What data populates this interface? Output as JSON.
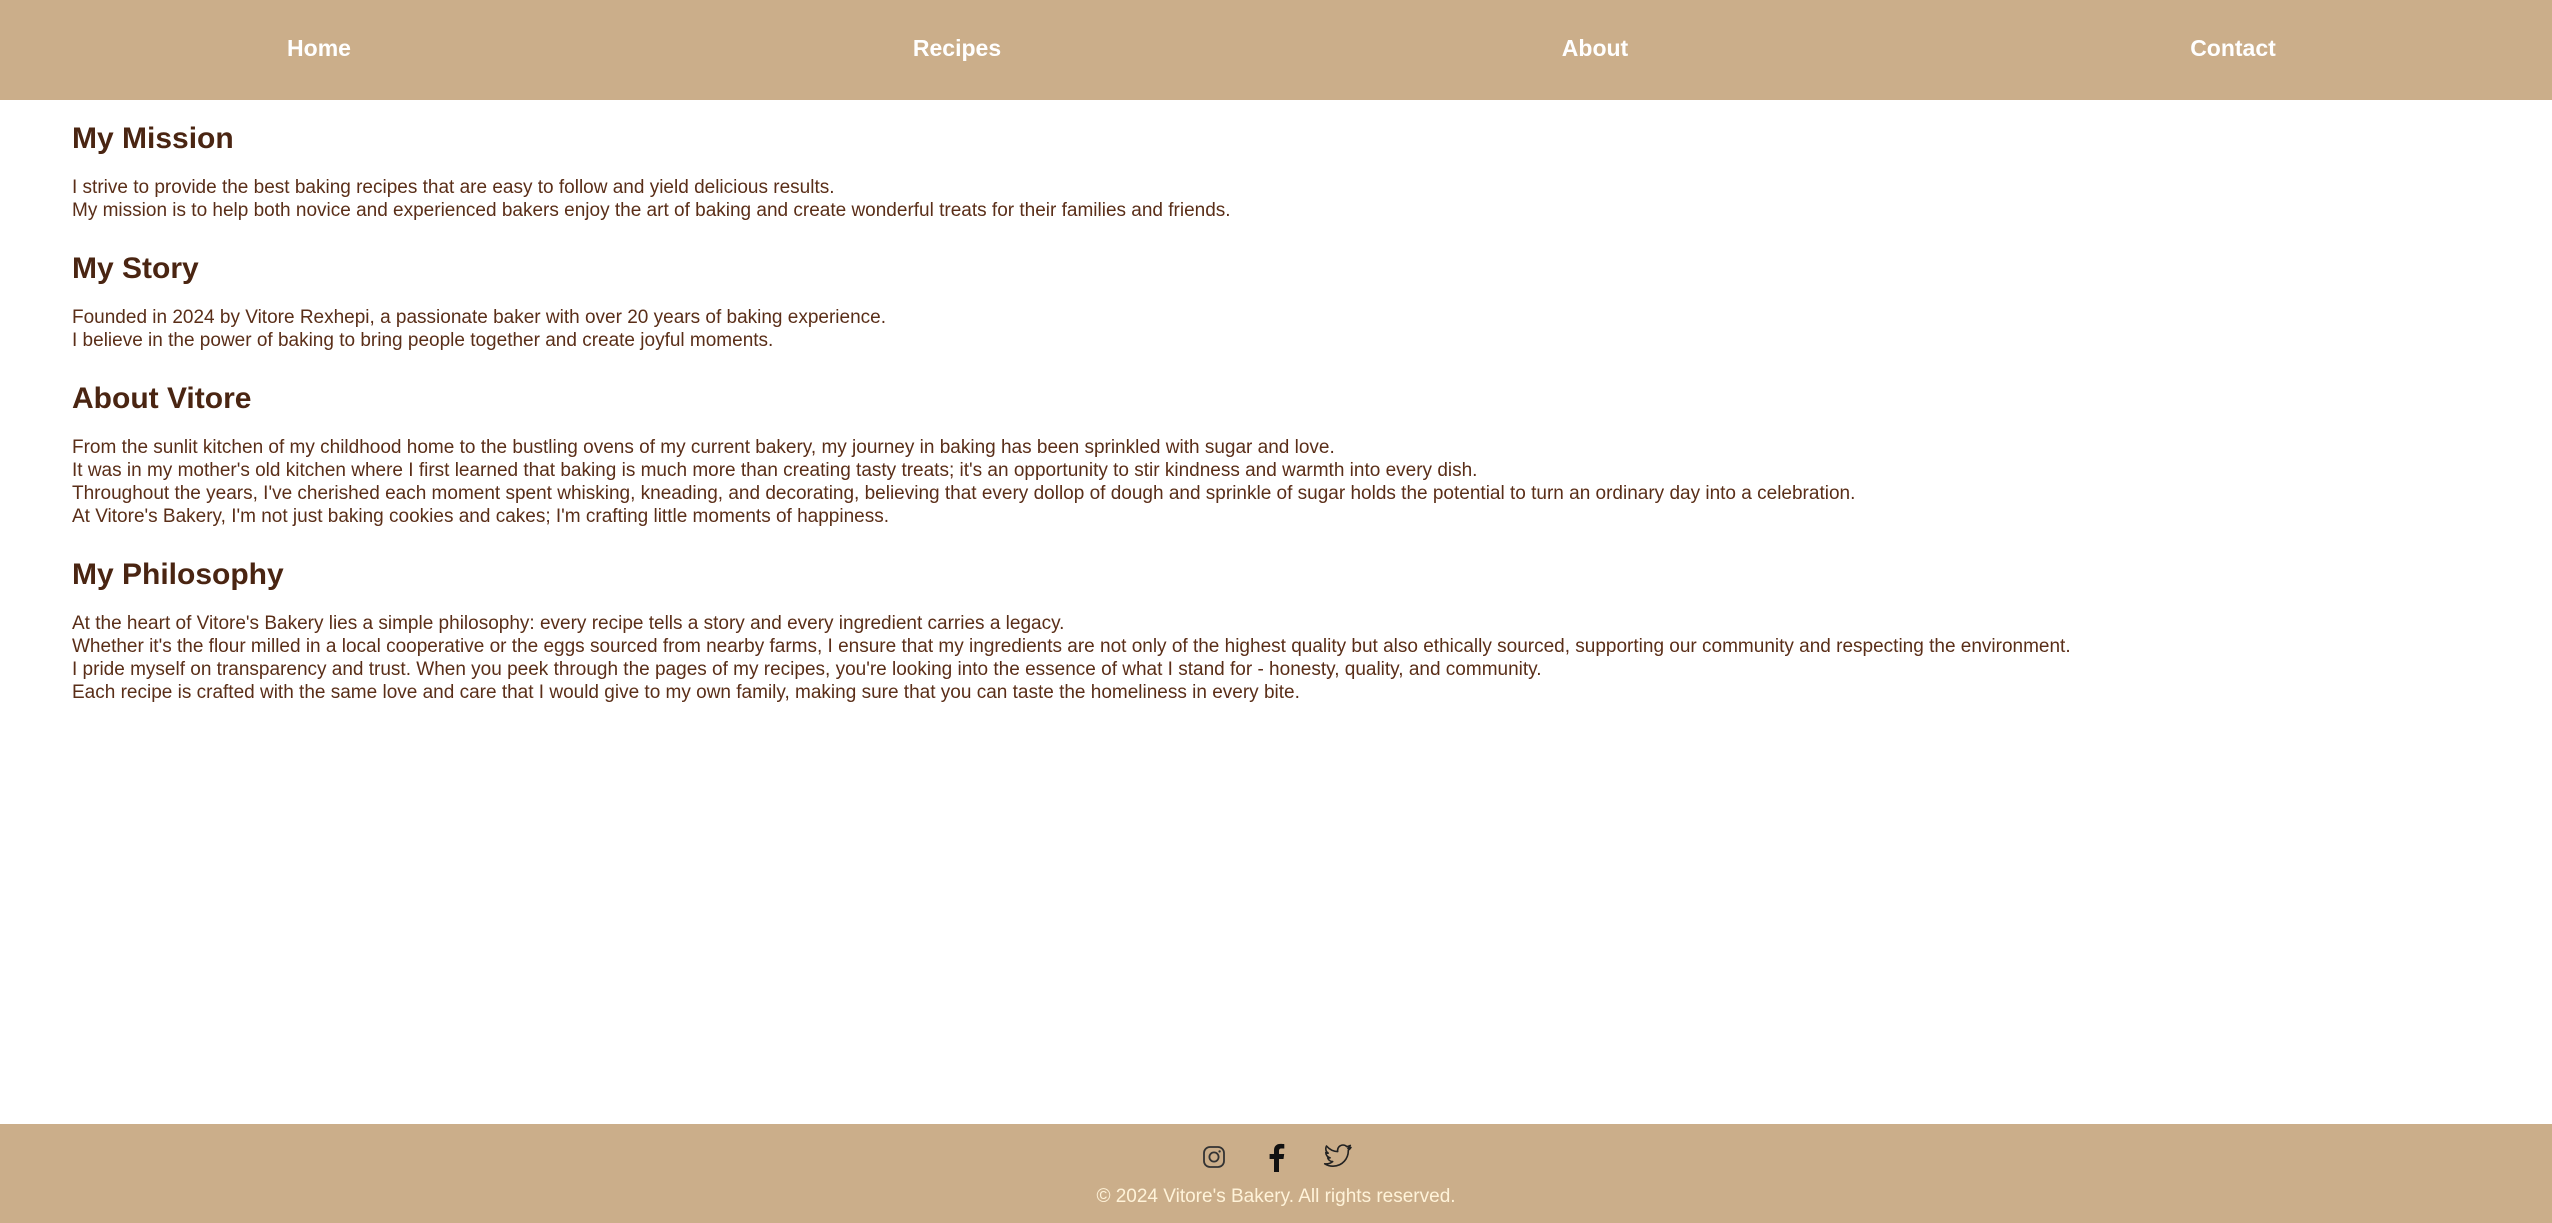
{
  "nav": {
    "items": [
      {
        "label": "Home"
      },
      {
        "label": "Recipes"
      },
      {
        "label": "About"
      },
      {
        "label": "Contact"
      }
    ]
  },
  "sections": [
    {
      "title": "My Mission",
      "lines": [
        "I strive to provide the best baking recipes that are easy to follow and yield delicious results.",
        "My mission is to help both novice and experienced bakers enjoy the art of baking and create wonderful treats for their families and friends."
      ]
    },
    {
      "title": "My Story",
      "lines": [
        "Founded in 2024 by Vitore Rexhepi, a passionate baker with over 20 years of baking experience.",
        "I believe in the power of baking to bring people together and create joyful moments."
      ]
    },
    {
      "title": "About Vitore",
      "lines": [
        "From the sunlit kitchen of my childhood home to the bustling ovens of my current bakery, my journey in baking has been sprinkled with sugar and love.",
        "It was in my mother's old kitchen where I first learned that baking is much more than creating tasty treats; it's an opportunity to stir kindness and warmth into every dish.",
        "Throughout the years, I've cherished each moment spent whisking, kneading, and decorating, believing that every dollop of dough and sprinkle of sugar holds the potential to turn an ordinary day into a celebration.",
        "At Vitore's Bakery, I'm not just baking cookies and cakes; I'm crafting little moments of happiness."
      ]
    },
    {
      "title": "My Philosophy",
      "lines": [
        "At the heart of Vitore's Bakery lies a simple philosophy: every recipe tells a story and every ingredient carries a legacy.",
        "Whether it's the flour milled in a local cooperative or the eggs sourced from nearby farms, I ensure that my ingredients are not only of the highest quality but also ethically sourced, supporting our community and respecting the environment.",
        "I pride myself on transparency and trust. When you peek through the pages of my recipes, you're looking into the essence of what I stand for - honesty, quality, and community.",
        "Each recipe is crafted with the same love and care that I would give to my own family, making sure that you can taste the homeliness in every bite."
      ]
    }
  ],
  "footer": {
    "social": [
      {
        "icon": "instagram-icon"
      },
      {
        "icon": "facebook-icon"
      },
      {
        "icon": "twitter-icon"
      }
    ],
    "copyright": "© 2024 Vitore's Bakery. All rights reserved."
  },
  "colors": {
    "nav_bg": "#cbae8a",
    "heading": "#4a2512",
    "text": "#5a2e18",
    "copyright": "#fff3d9"
  }
}
